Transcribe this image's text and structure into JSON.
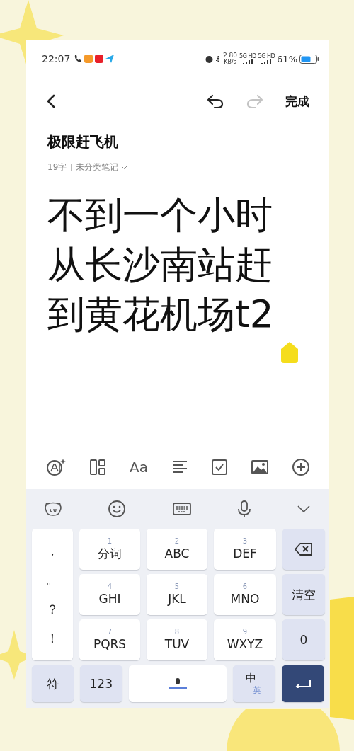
{
  "status_bar": {
    "time": "22:07",
    "speed_value": "2.80",
    "speed_unit": "KB/s",
    "sim_labels": [
      "5G HD",
      "5G HD"
    ],
    "battery": "61%"
  },
  "header": {
    "redo_disabled": true,
    "done": "完成"
  },
  "note": {
    "title": "极限赶飞机",
    "word_count": "19字",
    "category": "未分类笔记",
    "body_lines": [
      "不到一个小时",
      "从长沙南站赶",
      "到黄花机场t2"
    ]
  },
  "format_toolbar": {
    "font_label": "Aa"
  },
  "keyboard": {
    "punctuation": [
      "，",
      "。",
      "？",
      "！"
    ],
    "letter_keys": [
      {
        "digit": "1",
        "label": "分词"
      },
      {
        "digit": "2",
        "label": "ABC"
      },
      {
        "digit": "3",
        "label": "DEF"
      },
      {
        "digit": "4",
        "label": "GHI"
      },
      {
        "digit": "5",
        "label": "JKL"
      },
      {
        "digit": "6",
        "label": "MNO"
      },
      {
        "digit": "7",
        "label": "PQRS"
      },
      {
        "digit": "8",
        "label": "TUV"
      },
      {
        "digit": "9",
        "label": "WXYZ"
      }
    ],
    "clear": "清空",
    "zero": "0",
    "symbols": "符",
    "numbers": "123",
    "lang_main": "中",
    "lang_alt": "英"
  }
}
